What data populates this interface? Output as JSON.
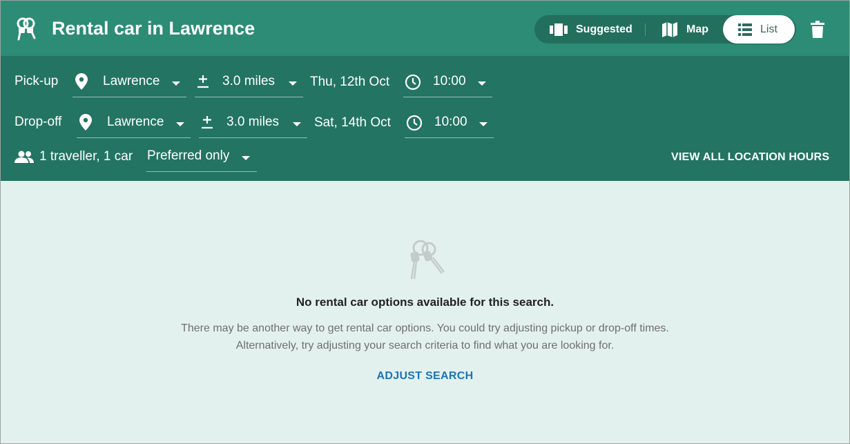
{
  "header": {
    "title": "Rental car in Lawrence",
    "view_toggle": [
      {
        "label": "Suggested",
        "icon": "carousel-icon",
        "active": false
      },
      {
        "label": "Map",
        "icon": "map-icon",
        "active": false
      },
      {
        "label": "List",
        "icon": "list-icon",
        "active": true
      }
    ],
    "delete_icon": "trash-icon"
  },
  "filters": {
    "pickup": {
      "label": "Pick-up",
      "location": "Lawrence",
      "radius": "3.0 miles",
      "date": "Thu, 12th Oct",
      "time": "10:00"
    },
    "dropoff": {
      "label": "Drop-off",
      "location": "Lawrence",
      "radius": "3.0 miles",
      "date": "Sat, 14th Oct",
      "time": "10:00"
    },
    "travellers": "1 traveller, 1 car",
    "preference": "Preferred only",
    "view_hours": "VIEW ALL LOCATION HOURS"
  },
  "empty_state": {
    "heading": "No rental car options available for this search.",
    "line1": "There may be another way to get rental car options. You could try adjusting pickup or drop-off times.",
    "line2": "Alternatively, try adjusting your search criteria to find what you are looking for.",
    "action": "ADJUST SEARCH"
  },
  "colors": {
    "header_bg": "#2c8c76",
    "filters_bg": "#237462",
    "content_bg": "#e3f1ee",
    "link": "#1b73b8"
  }
}
